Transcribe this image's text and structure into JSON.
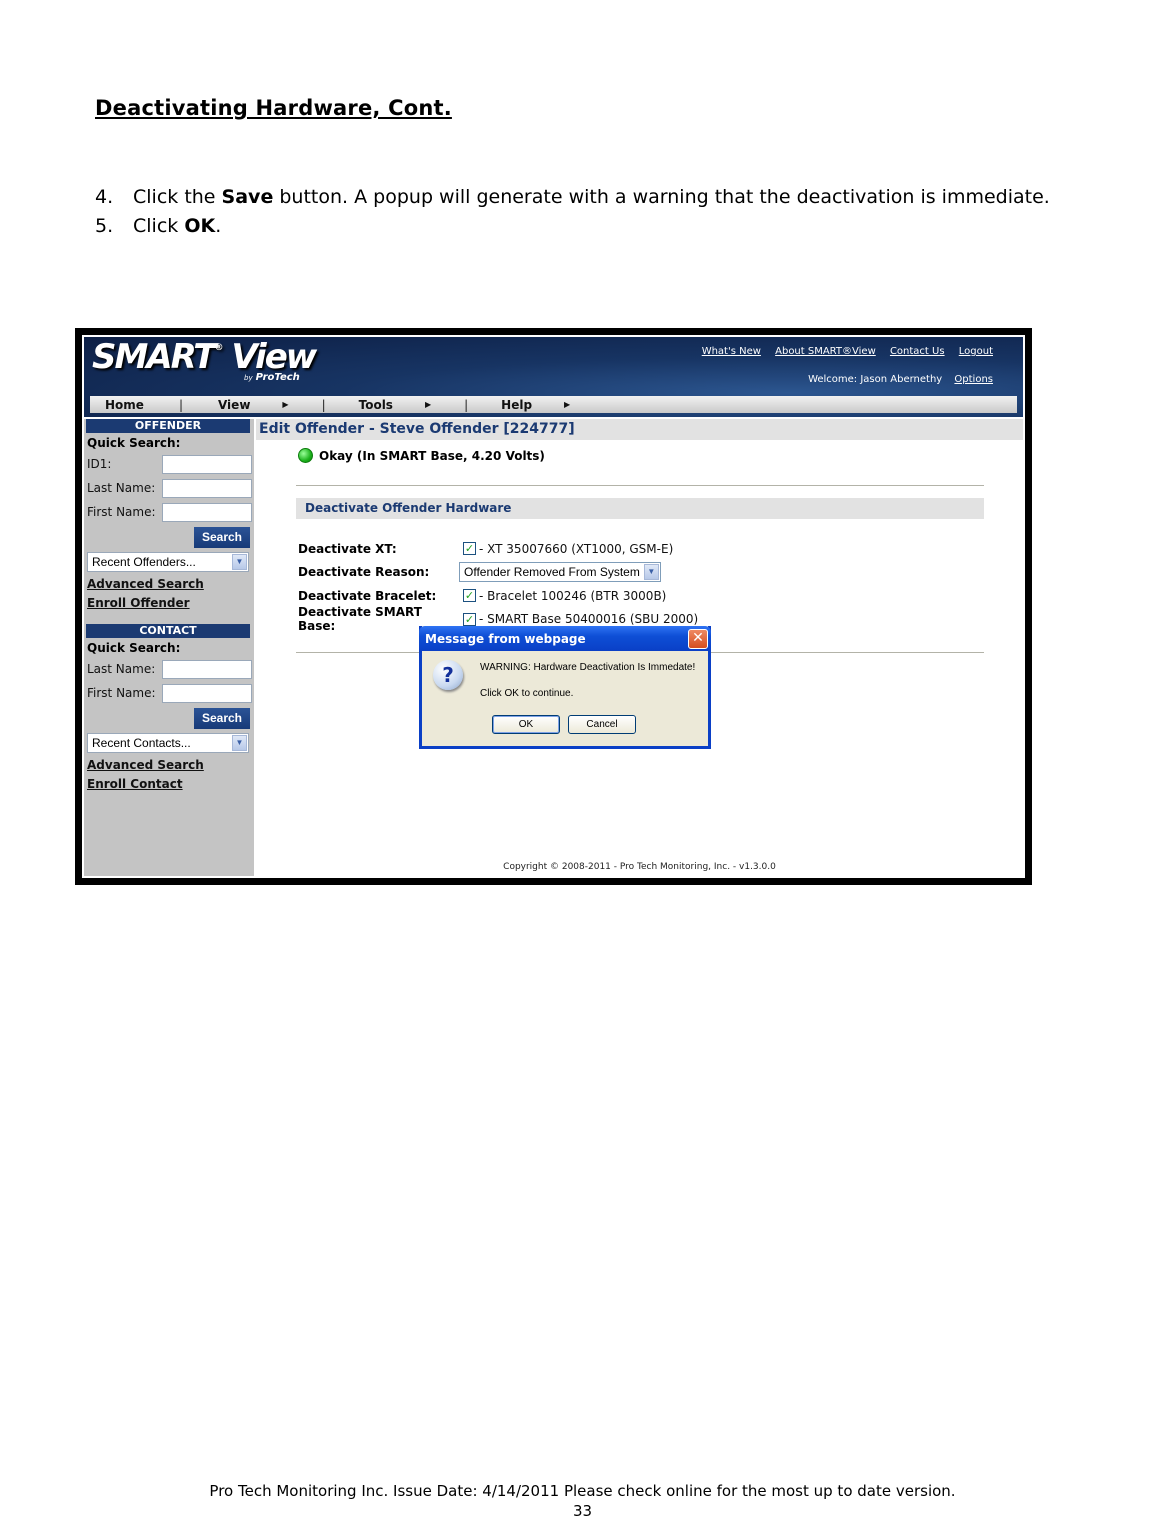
{
  "document": {
    "title": "Deactivating Hardware, Cont.",
    "steps": [
      {
        "num": "4.",
        "pre": "Click the ",
        "bold": "Save",
        "post": " button. A popup will generate with a warning that the deactivation is immediate."
      },
      {
        "num": "5.",
        "pre": "Click ",
        "bold": "OK",
        "post": "."
      }
    ],
    "footer_line": "Pro Tech Monitoring Inc. Issue Date: 4/14/2011 Please check online for the most up to date version.",
    "page_number": "33"
  },
  "app": {
    "logo": "SMART",
    "logo_view": "View",
    "logo_reg": "®",
    "logo_by": "by",
    "logo_brand": "ProTech",
    "top_links": [
      "What's New",
      "About SMART®View",
      "Contact Us",
      "Logout"
    ],
    "welcome": "Welcome: Jason Abernethy",
    "options_link": "Options",
    "menu": [
      {
        "label": "Home",
        "has_submenu": false
      },
      {
        "label": "View",
        "has_submenu": true
      },
      {
        "label": "Tools",
        "has_submenu": true
      },
      {
        "label": "Help",
        "has_submenu": true
      }
    ],
    "menu_separator": "|",
    "submenu_arrow": "▶",
    "sidebar": {
      "offender": {
        "header": "OFFENDER",
        "quick_search": "Quick Search:",
        "fields": [
          {
            "label": "ID1:",
            "value": ""
          },
          {
            "label": "Last Name:",
            "value": ""
          },
          {
            "label": "First Name:",
            "value": ""
          }
        ],
        "search_button": "Search",
        "recent_select": "Recent Offenders...",
        "links": [
          "Advanced Search",
          "Enroll Offender"
        ]
      },
      "contact": {
        "header": "CONTACT",
        "quick_search": "Quick Search:",
        "fields": [
          {
            "label": "Last Name:",
            "value": ""
          },
          {
            "label": "First Name:",
            "value": ""
          }
        ],
        "search_button": "Search",
        "recent_select": "Recent Contacts...",
        "links": [
          "Advanced Search",
          "Enroll Contact"
        ]
      }
    },
    "main": {
      "page_title": "Edit Offender - Steve Offender [224777]",
      "status_text": "Okay (In SMART Base, 4.20 Volts)",
      "status_color": "#1cb21c",
      "section_title": "Deactivate Offender Hardware",
      "rows": [
        {
          "label": "Deactivate XT:",
          "type": "checkbox",
          "checked": true,
          "value": "- XT 35007660 (XT1000, GSM-E)"
        },
        {
          "label": "Deactivate Reason:",
          "type": "select",
          "value": "Offender Removed From System"
        },
        {
          "label": "Deactivate Bracelet:",
          "type": "checkbox",
          "checked": true,
          "value": "- Bracelet 100246 (BTR 3000B)"
        },
        {
          "label": "Deactivate SMART Base:",
          "type": "checkbox",
          "checked": true,
          "value": "- SMART Base 50400016 (SBU 2000)"
        }
      ],
      "copyright": "Copyright © 2008-2011 - Pro Tech Monitoring, Inc. - v1.3.0.0"
    },
    "dialog": {
      "title": "Message from webpage",
      "close_glyph": "✕",
      "icon_glyph": "?",
      "message": "WARNING: Hardware Deactivation Is Immedate!",
      "sub_message": "Click OK to continue.",
      "ok_label": "OK",
      "cancel_label": "Cancel"
    },
    "icons": {
      "check": "✓",
      "dropdown": "▼"
    }
  }
}
